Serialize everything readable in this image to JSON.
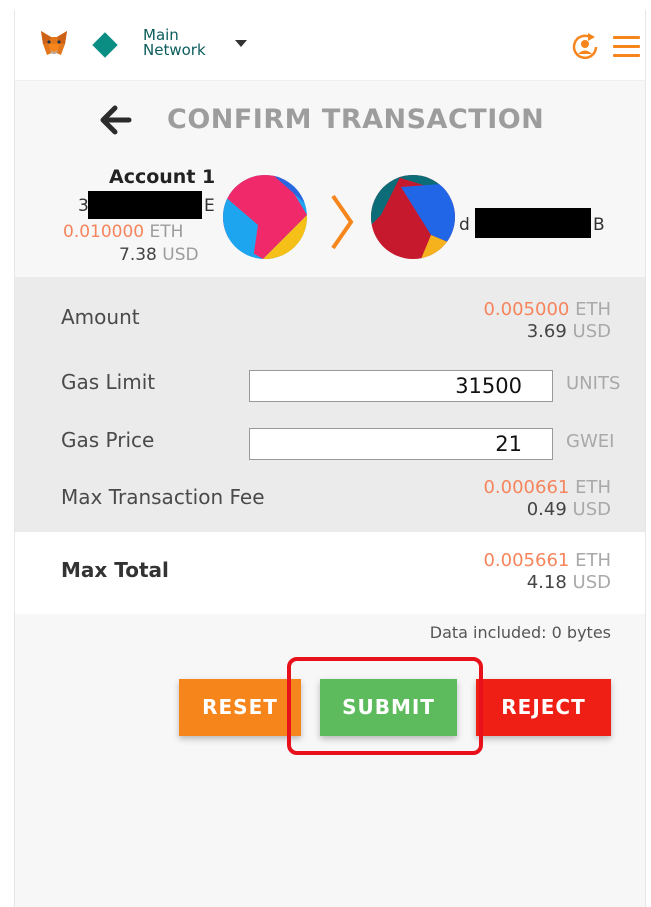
{
  "header": {
    "network_line1": "Main",
    "network_line2": "Network",
    "logo_icon": "metamask-fox-icon",
    "network_icon": "network-diamond-icon",
    "account_icon": "account-switch-icon",
    "menu_icon": "hamburger-menu-icon"
  },
  "title": "CONFIRM TRANSACTION",
  "from": {
    "name": "Account 1",
    "address_start": "3",
    "address_end": "E",
    "eth_amount": "0.010000",
    "eth_unit": "ETH",
    "usd_amount": "7.38",
    "usd_unit": "USD"
  },
  "to": {
    "address_start": "d",
    "address_end": "B"
  },
  "rows": {
    "amount": {
      "label": "Amount",
      "eth": "0.005000",
      "eth_unit": "ETH",
      "usd": "3.69",
      "usd_unit": "USD"
    },
    "gas_limit": {
      "label": "Gas Limit",
      "value": "31500",
      "unit": "UNITS"
    },
    "gas_price": {
      "label": "Gas Price",
      "value": "21",
      "unit": "GWEI"
    },
    "max_fee": {
      "label": "Max Transaction Fee",
      "eth": "0.000661",
      "eth_unit": "ETH",
      "usd": "0.49",
      "usd_unit": "USD"
    }
  },
  "total": {
    "label": "Max Total",
    "eth": "0.005661",
    "eth_unit": "ETH",
    "usd": "4.18",
    "usd_unit": "USD"
  },
  "data_included": "Data included: 0 bytes",
  "buttons": {
    "reset": "RESET",
    "submit": "SUBMIT",
    "reject": "REJECT"
  },
  "colors": {
    "accent_orange": "#f6851b",
    "submit_green": "#5dbb5d",
    "reject_red": "#f01f16",
    "highlight_red": "#e8101a",
    "network_teal": "#0a8e84"
  }
}
